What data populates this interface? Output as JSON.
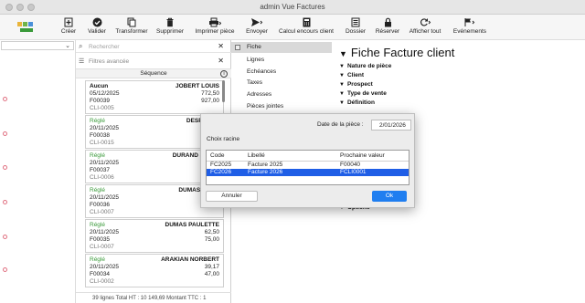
{
  "window": {
    "title": "admin Vue Factures"
  },
  "toolbar": {
    "buttons": [
      {
        "label": "Créer",
        "icon": "plus-doc-icon"
      },
      {
        "label": "Valider",
        "icon": "check-circle-icon"
      },
      {
        "label": "Transformer",
        "icon": "copy-icon"
      },
      {
        "label": "Supprimer",
        "icon": "trash-icon"
      },
      {
        "label": "Imprimer pièce",
        "icon": "printer-icon"
      },
      {
        "label": "Envoyer",
        "icon": "send-icon"
      },
      {
        "label": "Calcul encours client",
        "icon": "calculator-icon"
      },
      {
        "label": "Dossier",
        "icon": "folder-icon"
      },
      {
        "label": "Réserver",
        "icon": "lock-icon"
      },
      {
        "label": "Afficher tout",
        "icon": "refresh-icon"
      },
      {
        "label": "Evénements",
        "icon": "flag-icon"
      }
    ]
  },
  "list": {
    "search_placeholder": "Rechercher",
    "filters_placeholder": "Filtres avancée",
    "sequence_label": "Séquence",
    "cards": [
      {
        "status": "Aucun",
        "client": "JOBERT LOUIS",
        "date": "05/12/2025",
        "ht": "772,50",
        "number": "F00039",
        "ttc": "927,00",
        "cli": "CLI-0005"
      },
      {
        "status": "Réglé",
        "client": "DESPRET J",
        "date": "20/11/2025",
        "ht": "",
        "number": "F00038",
        "ttc": "",
        "cli": "CLI-0015"
      },
      {
        "status": "Réglé",
        "client": "DURAND JEAN-I",
        "date": "20/11/2025",
        "ht": "",
        "number": "F00037",
        "ttc": "",
        "cli": "CLI-0006"
      },
      {
        "status": "Réglé",
        "client": "DUMAS PAULI",
        "date": "20/11/2025",
        "ht": "",
        "number": "F00036",
        "ttc": "",
        "cli": "CLI-0007"
      },
      {
        "status": "Réglé",
        "client": "DUMAS PAULETTE",
        "date": "20/11/2025",
        "ht": "62,50",
        "number": "F00035",
        "ttc": "75,00",
        "cli": "CLI-0007"
      },
      {
        "status": "Réglé",
        "client": "ARAKIAN NORBERT",
        "date": "20/11/2025",
        "ht": "39,17",
        "number": "F00034",
        "ttc": "47,00",
        "cli": "CLI-0002"
      }
    ],
    "footer": "39 lignes Total HT : 10 149,69 Montant TTC : 1"
  },
  "nav": {
    "items": [
      "Fiche",
      "Lignes",
      "Echéances",
      "Taxes",
      "Adresses",
      "Pièces jointes"
    ]
  },
  "detail": {
    "title": "Fiche Facture client",
    "sections": [
      "Nature de pièce",
      "Client",
      "Prospect",
      "Type de vente",
      "Définition",
      "Options"
    ]
  },
  "modal": {
    "date_label": "Date de la pièce :",
    "date_value": "2/01/2026",
    "section_title": "Choix racine",
    "columns": [
      "Code",
      "Libellé",
      "Prochaine valeur"
    ],
    "rows": [
      {
        "code": "FC2025",
        "libelle": "Facture 2025",
        "prochaine": "F00040"
      },
      {
        "code": "FC2026",
        "libelle": "Facture 2026",
        "prochaine": "FCLI0001"
      }
    ],
    "selected_row": 1,
    "cancel_label": "Annuler",
    "ok_label": "Ok"
  },
  "colors": {
    "accent": "#1f7ef0",
    "selection": "#1f5ee6",
    "status_paid": "#3a9a3a"
  }
}
